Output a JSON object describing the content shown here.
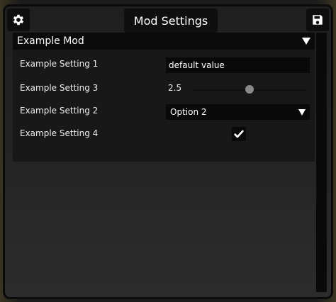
{
  "window": {
    "title": "Mod Settings"
  },
  "icons": {
    "settings": "gear-icon",
    "save": "floppy-disk-icon",
    "collapse": "triangle-down-icon",
    "dropdown": "triangle-down-icon",
    "check": "checkmark-icon"
  },
  "mod": {
    "name": "Example Mod",
    "settings": {
      "setting1": {
        "label": "Example Setting 1",
        "value": "default value"
      },
      "setting3": {
        "label": "Example Setting 3",
        "value": "2.5",
        "slider_fraction": 0.5
      },
      "setting2": {
        "label": "Example Setting 2",
        "selected": "Option 2"
      },
      "setting4": {
        "label": "Example Setting 4",
        "checked": true
      }
    }
  },
  "colors": {
    "window_border": "#0b0b0b",
    "header_bg": "#0b0b0b",
    "field_bg": "#0a0a0a",
    "text": "#ffffff",
    "slider_thumb": "#8a8a8a"
  }
}
